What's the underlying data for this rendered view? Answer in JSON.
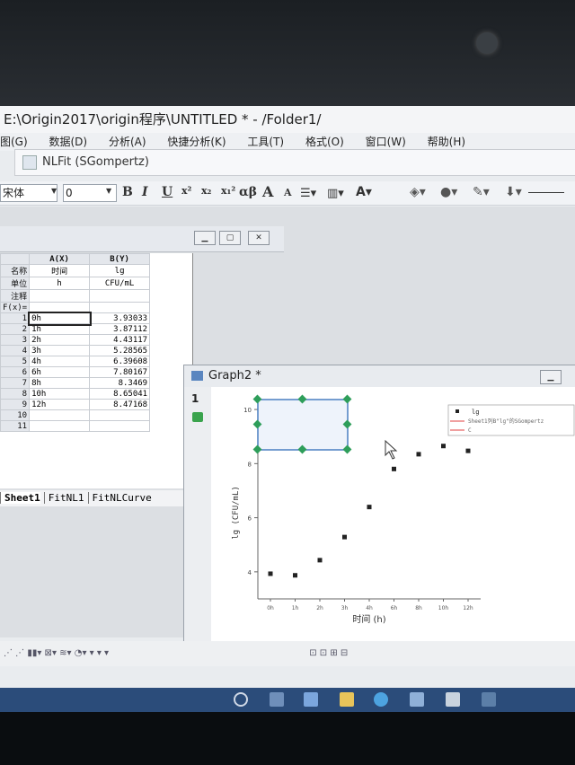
{
  "window": {
    "title": "E:\\Origin2017\\origin程序\\UNTITLED * - /Folder1/"
  },
  "menu": [
    "图(G)",
    "数据(D)",
    "分析(A)",
    "快捷分析(K)",
    "工具(T)",
    "格式(O)",
    "窗口(W)",
    "帮助(H)"
  ],
  "nlfit": {
    "title": "NLFit (SGompertz)"
  },
  "toolbar": {
    "font_name": "宋体",
    "font_size": "0",
    "bold": "B",
    "italic": "I",
    "underline": "U",
    "greek": "αβ",
    "A_big": "A",
    "A_small": "A"
  },
  "sheet": {
    "col_headers": [
      "A(X)",
      "B(Y)"
    ],
    "meta_rows": [
      {
        "label": "名称",
        "a": "时间",
        "b": "lg"
      },
      {
        "label": "单位",
        "a": "h",
        "b": "CFU/mL"
      },
      {
        "label": "注释",
        "a": "",
        "b": ""
      },
      {
        "label": "F(x)=",
        "a": "",
        "b": ""
      }
    ],
    "rows": [
      {
        "n": "1",
        "a": "0h",
        "b": "3.93033"
      },
      {
        "n": "2",
        "a": "1h",
        "b": "3.87112"
      },
      {
        "n": "3",
        "a": "2h",
        "b": "4.43117"
      },
      {
        "n": "4",
        "a": "3h",
        "b": "5.28565"
      },
      {
        "n": "5",
        "a": "4h",
        "b": "6.39608"
      },
      {
        "n": "6",
        "a": "6h",
        "b": "7.80167"
      },
      {
        "n": "7",
        "a": "8h",
        "b": "8.3469"
      },
      {
        "n": "8",
        "a": "10h",
        "b": "8.65041"
      },
      {
        "n": "9",
        "a": "12h",
        "b": "8.47168"
      },
      {
        "n": "10",
        "a": "",
        "b": ""
      },
      {
        "n": "11",
        "a": "",
        "b": ""
      }
    ],
    "tabs": [
      "Sheet1",
      "FitNL1",
      "FitNLCurve"
    ]
  },
  "graph": {
    "title": "Graph2 *",
    "layer": "1",
    "legend": {
      "series": "lg",
      "fit": "Sheet1列B\"lg\"的SGompertz",
      "ci": "C"
    },
    "chart_data": {
      "type": "scatter",
      "categories": [
        "0h",
        "1h",
        "2h",
        "3h",
        "4h",
        "6h",
        "8h",
        "10h",
        "12h"
      ],
      "values": [
        3.93033,
        3.87112,
        4.43117,
        5.28565,
        6.39608,
        7.80167,
        8.3469,
        8.65041,
        8.47168
      ],
      "xlabel": "时间 (h)",
      "ylabel": "lg (CFU/mL)",
      "yticks": [
        4,
        6,
        8,
        10
      ],
      "ylim": [
        3,
        10.5
      ],
      "grid": false,
      "legend_position": "top-right"
    }
  },
  "colors": {
    "marker": "#222222",
    "fit_line": "#e04040",
    "handle": "#2e9e5a",
    "select_box": "#4a7fc1",
    "taskbar": "#2b4c7a"
  }
}
